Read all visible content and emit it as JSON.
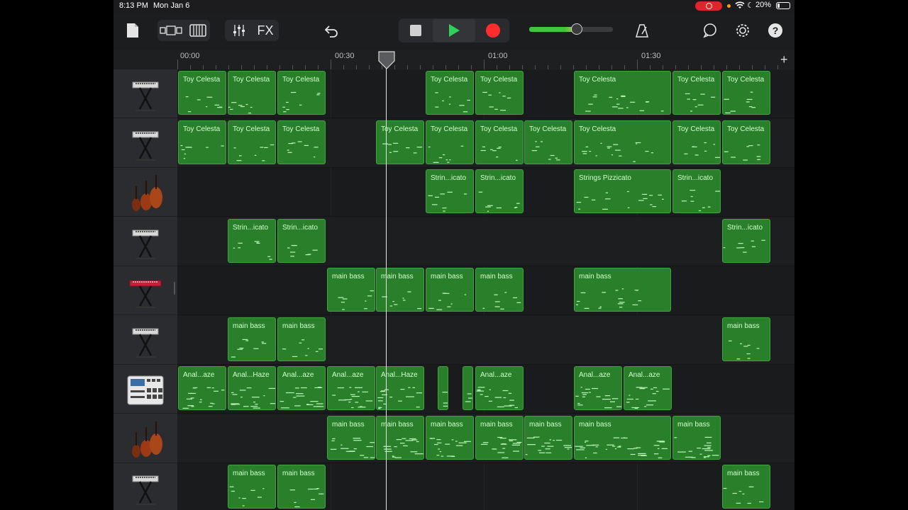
{
  "status": {
    "time": "8:13 PM",
    "date": "Mon Jan 6",
    "battery_text": "20%",
    "battery_level": 0.2
  },
  "toolbar": {
    "fx_label": "FX",
    "master_volume_level": 0.6,
    "colors": {
      "play": "#2fd158",
      "record": "#ff2d2d",
      "accent": "#e6e6e6"
    }
  },
  "ruler": {
    "labels": [
      "00:00",
      "00:30",
      "01:00",
      "01:30"
    ]
  },
  "tracks": [
    {
      "icon": "keyboard-stand-icon",
      "regions": [
        {
          "label": "Toy Celesta"
        },
        {
          "label": "Toy Celesta"
        },
        {
          "label": "Toy Celesta"
        },
        {
          "label": "Toy Celesta"
        },
        {
          "label": "Toy Celesta"
        },
        {
          "label": "Toy Celesta"
        },
        {
          "label": "Toy Celesta"
        },
        {
          "label": "Toy Celesta"
        }
      ]
    },
    {
      "icon": "keyboard-stand-icon",
      "regions": [
        {
          "label": "Toy Celesta"
        },
        {
          "label": "Toy Celesta"
        },
        {
          "label": "Toy Celesta"
        },
        {
          "label": "Toy Celesta"
        },
        {
          "label": "Toy Celesta"
        },
        {
          "label": "Toy Celesta"
        },
        {
          "label": "Toy Celesta"
        },
        {
          "label": "Toy Celesta"
        },
        {
          "label": "Toy Celesta"
        },
        {
          "label": "Toy Celesta"
        }
      ]
    },
    {
      "icon": "strings-icon",
      "regions": [
        {
          "label": "Strin...icato"
        },
        {
          "label": "Strin...icato"
        },
        {
          "label": "Strings Pizzicato"
        },
        {
          "label": "Strin...icato"
        }
      ]
    },
    {
      "icon": "keyboard-stand-icon",
      "regions": [
        {
          "label": "Strin...icato"
        },
        {
          "label": "Strin...icato"
        },
        {
          "label": "Strin...icato"
        }
      ]
    },
    {
      "icon": "red-synth-icon",
      "regions": [
        {
          "label": "main bass"
        },
        {
          "label": "main bass"
        },
        {
          "label": "main bass"
        },
        {
          "label": "main bass"
        },
        {
          "label": "main bass"
        }
      ]
    },
    {
      "icon": "keyboard-stand-icon",
      "regions": [
        {
          "label": "main bass"
        },
        {
          "label": "main bass"
        },
        {
          "label": "main bass"
        }
      ]
    },
    {
      "icon": "drum-machine-icon",
      "regions": [
        {
          "label": "Anal...aze"
        },
        {
          "label": "Anal...Haze"
        },
        {
          "label": "Anal...aze"
        },
        {
          "label": "Anal...aze"
        },
        {
          "label": "Anal...Haze"
        },
        {
          "label": ""
        },
        {
          "label": ""
        },
        {
          "label": "Anal...aze"
        },
        {
          "label": "Anal...aze"
        },
        {
          "label": "Anal...aze"
        }
      ]
    },
    {
      "icon": "strings-icon",
      "regions": [
        {
          "label": "main bass"
        },
        {
          "label": "main bass"
        },
        {
          "label": "main bass"
        },
        {
          "label": "main bass"
        },
        {
          "label": "main bass"
        },
        {
          "label": "main bass"
        },
        {
          "label": "main bass"
        }
      ]
    },
    {
      "icon": "keyboard-stand-icon",
      "regions": [
        {
          "label": "main bass"
        },
        {
          "label": "main bass"
        },
        {
          "label": "main bass"
        }
      ]
    }
  ]
}
